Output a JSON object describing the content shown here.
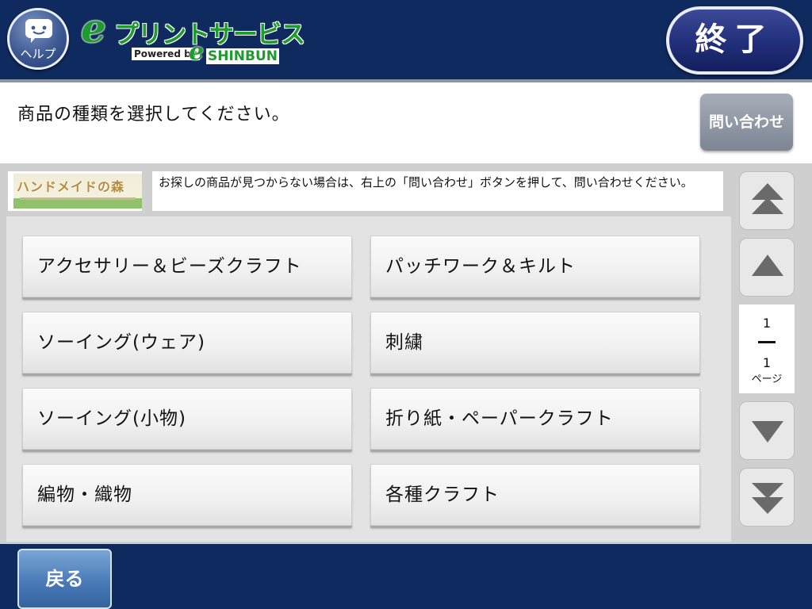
{
  "header": {
    "help_label": "ヘルプ",
    "logo_e": "e",
    "logo_title": "プリントサービス",
    "logo_powered": "Powered by",
    "logo_shinbun": "SHINBUN",
    "end_label": "終了"
  },
  "instruction": "商品の種類を選択してください。",
  "inquiry_label": "問い合わせ",
  "category_banner": {
    "thumb_text": "ハンドメイドの森",
    "notice": "お探しの商品が見つからない場合は、右上の「問い合わせ」ボタンを押して、問い合わせください。"
  },
  "items": [
    "アクセサリー＆ビーズクラフト",
    "パッチワーク＆キルト",
    "ソーイング(ウェア)",
    "刺繍",
    "ソーイング(小物)",
    "折り紙・ペーパークラフト",
    "編物・織物",
    "各種クラフト"
  ],
  "pager": {
    "current": "1",
    "total": "1",
    "unit": "ページ",
    "icons": [
      "double-up-icon",
      "up-icon",
      "down-icon",
      "double-down-icon"
    ]
  },
  "footer": {
    "back_label": "戻る"
  },
  "colors": {
    "header_bg": "#0f2a5e",
    "logo_green": "#1f9a2e",
    "end_button": "#23307c",
    "inquiry_button": "#8a92a0",
    "back_button": "#4a7bb7"
  }
}
